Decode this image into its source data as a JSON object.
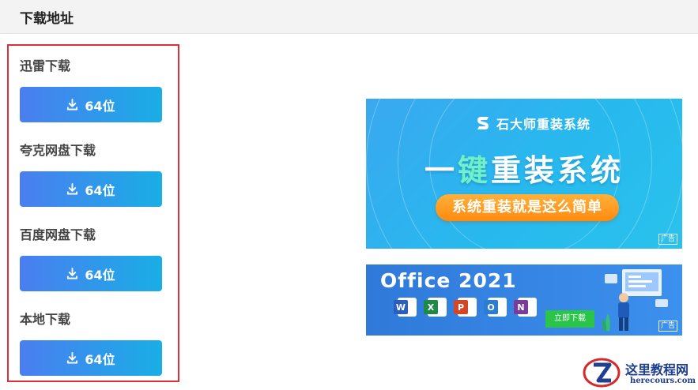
{
  "header": {
    "title": "下载地址"
  },
  "download_sections": [
    {
      "label": "迅雷下载",
      "button": "64位"
    },
    {
      "label": "夸克网盘下载",
      "button": "64位"
    },
    {
      "label": "百度网盘下载",
      "button": "64位"
    },
    {
      "label": "本地下载",
      "button": "64位"
    }
  ],
  "ads": {
    "reinstall": {
      "brand": "石大师重装系统",
      "headline_part1": "一",
      "headline_accent": "键",
      "headline_part2": "重装系统",
      "pill": "系统重装就是这么简单",
      "tag": "广告"
    },
    "office": {
      "title": "Office 2021",
      "apps": [
        {
          "letter": "W",
          "color": "#2b5fbd"
        },
        {
          "letter": "X",
          "color": "#1f8a45"
        },
        {
          "letter": "P",
          "color": "#d24726"
        },
        {
          "letter": "O",
          "color": "#2b7cd3"
        },
        {
          "letter": "N",
          "color": "#7a3b9b"
        }
      ],
      "cta": "立即下载",
      "tag": "广告"
    }
  },
  "watermark": {
    "title": "这里教程网",
    "url": "herecours.com"
  }
}
